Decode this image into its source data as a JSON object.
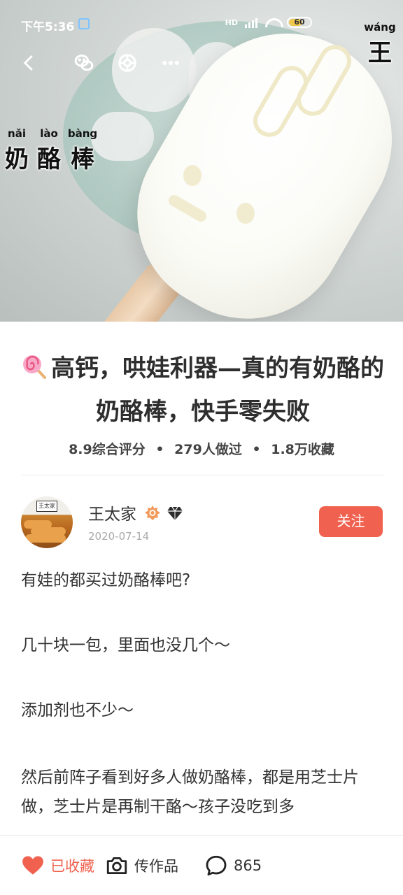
{
  "status_bar": {
    "time": "下午5:36",
    "network": "HD",
    "battery": "60"
  },
  "hero": {
    "overlay_words": [
      {
        "pinyin": "nǎi",
        "char": "奶"
      },
      {
        "pinyin": "lào",
        "char": "酪"
      },
      {
        "pinyin": "bàng",
        "char": "棒"
      }
    ],
    "watermark": {
      "pinyin": "wáng",
      "char": "王"
    }
  },
  "nav": {
    "icons": [
      "back-icon",
      "wechat-icon",
      "moments-icon",
      "more-icon"
    ]
  },
  "recipe": {
    "title": "高钙，哄娃利器—真的有奶酪的奶酪棒，快手零失败",
    "stats": {
      "rating": "8.9综合评分",
      "made": "279人做过",
      "saved": "1.8万收藏",
      "separator": "•"
    }
  },
  "author": {
    "name": "王太家",
    "date": "2020-07-14",
    "avatar_sign": "王太家",
    "follow_label": "关注"
  },
  "description": [
    "有娃的都买过奶酪棒吧?",
    "几十块一包，里面也没几个～",
    "添加剂也不少～",
    "然后前阵子看到好多人做奶酪棒，都是用芝士片做，芝士片是再制干酪～孩子没吃到多"
  ],
  "bottom_bar": {
    "favorite_label": "已收藏",
    "upload_label": "传作品",
    "comment_count": "865"
  },
  "colors": {
    "accent": "#f0624f",
    "text": "#333333",
    "muted": "#aaaaaa"
  }
}
